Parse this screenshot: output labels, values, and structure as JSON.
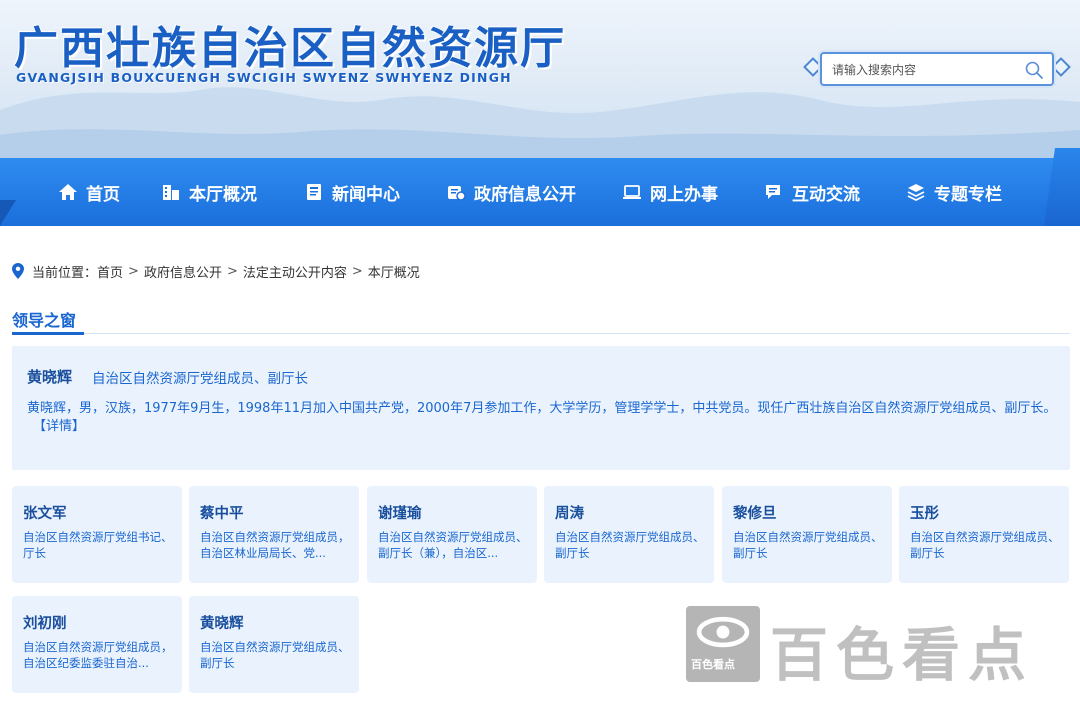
{
  "header": {
    "title": "广西壮族自治区自然资源厅",
    "subtitle": "GVANGJSIH BOUXCUENGH SWCIGIH SWYENZ SWHYENZ DINGH",
    "search_placeholder": "请输入搜索内容"
  },
  "nav": {
    "items": [
      {
        "label": "首页",
        "icon": "home-icon"
      },
      {
        "label": "本厅概况",
        "icon": "building-icon"
      },
      {
        "label": "新闻中心",
        "icon": "document-icon"
      },
      {
        "label": "政府信息公开",
        "icon": "info-disclosure-icon"
      },
      {
        "label": "网上办事",
        "icon": "laptop-icon"
      },
      {
        "label": "互动交流",
        "icon": "chat-icon"
      },
      {
        "label": "专题专栏",
        "icon": "layers-icon"
      }
    ]
  },
  "breadcrumb": {
    "prefix": "当前位置：",
    "items": [
      "首页",
      "政府信息公开",
      "法定主动公开内容",
      "本厅概况"
    ],
    "separator": ">"
  },
  "section": {
    "title": "领导之窗"
  },
  "featured": {
    "name": "黄晓辉",
    "title": "自治区自然资源厅党组成员、副厅长",
    "bio": "黄晓辉，男，汉族，1977年9月生，1998年11月加入中国共产党，2000年7月参加工作，大学学历，管理学学士，中共党员。现任广西壮族自治区自然资源厅党组成员、副厅长。",
    "detail_label": "【详情】"
  },
  "leaders": [
    {
      "name": "张文军",
      "desc": "自治区自然资源厅党组书记、厅长"
    },
    {
      "name": "蔡中平",
      "desc": "自治区自然资源厅党组成员，自治区林业局局长、党..."
    },
    {
      "name": "谢瑾瑜",
      "desc": "自治区自然资源厅党组成员、副厅长（兼），自治区..."
    },
    {
      "name": "周涛",
      "desc": "自治区自然资源厅党组成员、副厅长"
    },
    {
      "name": "黎修旦",
      "desc": "自治区自然资源厅党组成员、副厅长"
    },
    {
      "name": "玉彤",
      "desc": "自治区自然资源厅党组成员、副厅长"
    },
    {
      "name": "刘初刚",
      "desc": "自治区自然资源厅党组成员，自治区纪委监委驻自治..."
    },
    {
      "name": "黄晓辉",
      "desc": "自治区自然资源厅党组成员、副厅长"
    }
  ],
  "watermark": {
    "logo_text": "百色看点",
    "text": "百色看点"
  },
  "colors": {
    "primary": "#1a66d0",
    "nav": "#2f8cf0",
    "panel": "#eaf3fd"
  }
}
